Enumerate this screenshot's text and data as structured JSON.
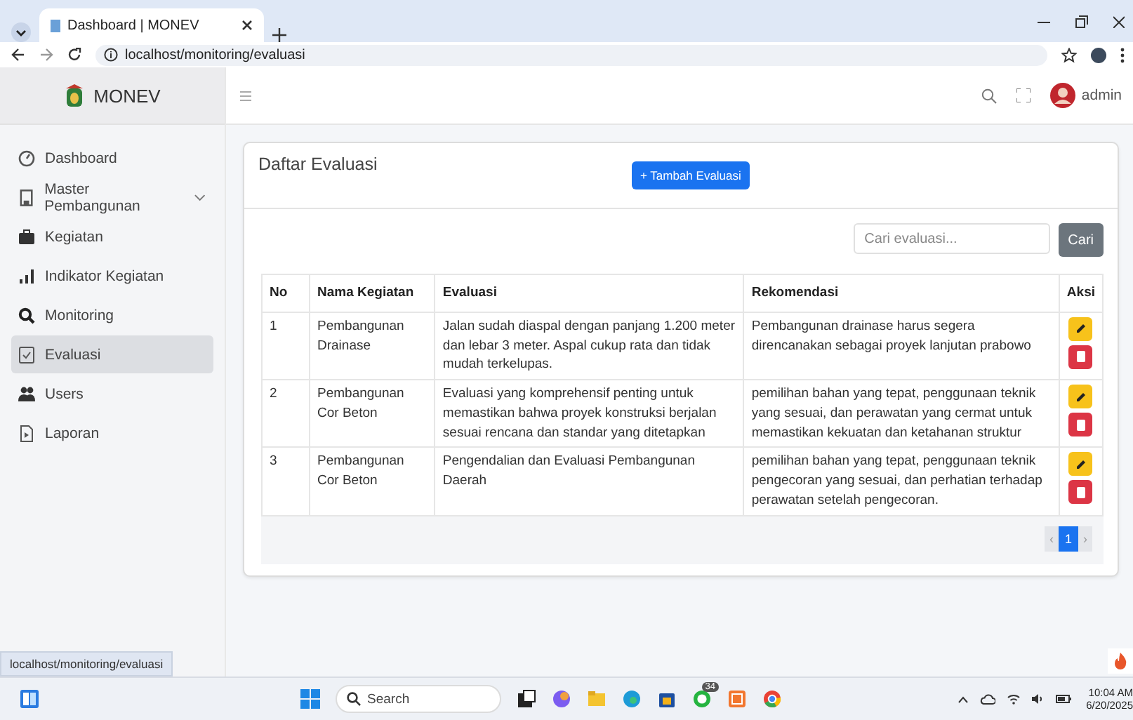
{
  "browser": {
    "tab_title": "Dashboard | MONEV",
    "url": "localhost/monitoring/evaluasi",
    "status_url": "localhost/monitoring/evaluasi"
  },
  "app": {
    "brand": "MONEV",
    "user": "admin"
  },
  "sidebar": {
    "items": [
      {
        "label": "Dashboard",
        "selected": false,
        "kind": "link"
      },
      {
        "label": "Master Pembangunan",
        "selected": false,
        "kind": "group"
      },
      {
        "label": "Kegiatan",
        "selected": false,
        "kind": "link"
      },
      {
        "label": "Indikator Kegiatan",
        "selected": false,
        "kind": "link"
      },
      {
        "label": "Monitoring",
        "selected": false,
        "kind": "link"
      },
      {
        "label": "Evaluasi",
        "selected": true,
        "kind": "link"
      },
      {
        "label": "Users",
        "selected": false,
        "kind": "link"
      },
      {
        "label": "Laporan",
        "selected": false,
        "kind": "link"
      }
    ]
  },
  "card": {
    "title": "Daftar Evaluasi",
    "add_button": "+ Tambah Evaluasi",
    "search": {
      "placeholder": "Cari evaluasi..."
    },
    "search_button": "Cari",
    "table": {
      "columns": [
        "No",
        "Nama Kegiatan",
        "Evaluasi",
        "Rekomendasi",
        "Aksi"
      ],
      "rows": [
        {
          "no": "1",
          "nama": "Pembangunan Drainase",
          "evaluasi": "Jalan sudah diaspal dengan panjang 1.200 meter dan lebar 3 meter. Aspal cukup rata dan tidak mudah terkelupas.",
          "rekomendasi": "Pembangunan drainase harus segera direncanakan sebagai proyek lanjutan prabowo"
        },
        {
          "no": "2",
          "nama": "Pembangunan Cor Beton",
          "evaluasi": "Evaluasi yang komprehensif penting untuk memastikan bahwa proyek konstruksi berjalan sesuai rencana dan standar yang ditetapkan",
          "rekomendasi": "pemilihan bahan yang tepat, penggunaan teknik yang sesuai, dan perawatan yang cermat untuk memastikan kekuatan dan ketahanan struktur"
        },
        {
          "no": "3",
          "nama": "Pembangunan Cor Beton",
          "evaluasi": "Pengendalian dan Evaluasi Pembangunan Daerah",
          "rekomendasi": "pemilihan bahan yang tepat, penggunaan teknik pengecoran yang sesuai, dan perhatian terhadap perawatan setelah pengecoran."
        }
      ]
    },
    "pagination": [
      {
        "label": "‹",
        "selected": false
      },
      {
        "label": "1",
        "selected": true
      },
      {
        "label": "›",
        "selected": false
      }
    ]
  },
  "taskbar": {
    "search": "Search",
    "badge": "34",
    "time": "10:04 AM",
    "date": "6/20/2025"
  }
}
